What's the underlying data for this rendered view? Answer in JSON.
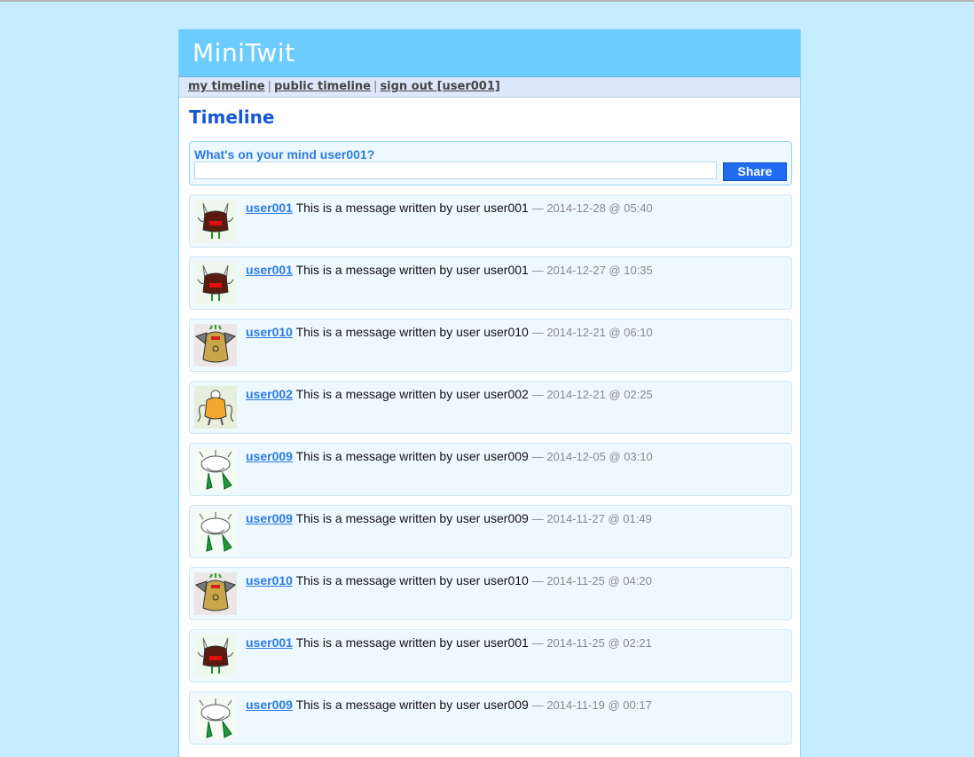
{
  "app": {
    "title": "MiniTwit"
  },
  "nav": {
    "my_timeline": "my timeline",
    "public_timeline": "public timeline",
    "sign_out": "sign out [user001]",
    "separator": "|"
  },
  "page_title": "Timeline",
  "twitbox": {
    "prompt": "What's on your mind user001?",
    "input_value": "",
    "share_label": "Share"
  },
  "messages": [
    {
      "user": "user001",
      "text": "This is a message written by user user001",
      "date": "— 2014-12-28 @ 05:40",
      "avatar": "monster-brown-horns-icon"
    },
    {
      "user": "user001",
      "text": "This is a message written by user user001",
      "date": "— 2014-12-27 @ 10:35",
      "avatar": "monster-brown-horns-icon"
    },
    {
      "user": "user010",
      "text": "This is a message written by user user010",
      "date": "— 2014-12-21 @ 06:10",
      "avatar": "monster-yellow-bat-icon"
    },
    {
      "user": "user002",
      "text": "This is a message written by user user002",
      "date": "— 2014-12-21 @ 02:25",
      "avatar": "monster-orange-tentacle-icon"
    },
    {
      "user": "user009",
      "text": "This is a message written by user user009",
      "date": "— 2014-12-05 @ 03:10",
      "avatar": "monster-green-legs-icon"
    },
    {
      "user": "user009",
      "text": "This is a message written by user user009",
      "date": "— 2014-11-27 @ 01:49",
      "avatar": "monster-green-legs-icon"
    },
    {
      "user": "user010",
      "text": "This is a message written by user user010",
      "date": "— 2014-11-25 @ 04:20",
      "avatar": "monster-yellow-bat-icon"
    },
    {
      "user": "user001",
      "text": "This is a message written by user user001",
      "date": "— 2014-11-25 @ 02:21",
      "avatar": "monster-brown-horns-icon"
    },
    {
      "user": "user009",
      "text": "This is a message written by user user009",
      "date": "— 2014-11-19 @ 00:17",
      "avatar": "monster-green-legs-icon"
    }
  ]
}
